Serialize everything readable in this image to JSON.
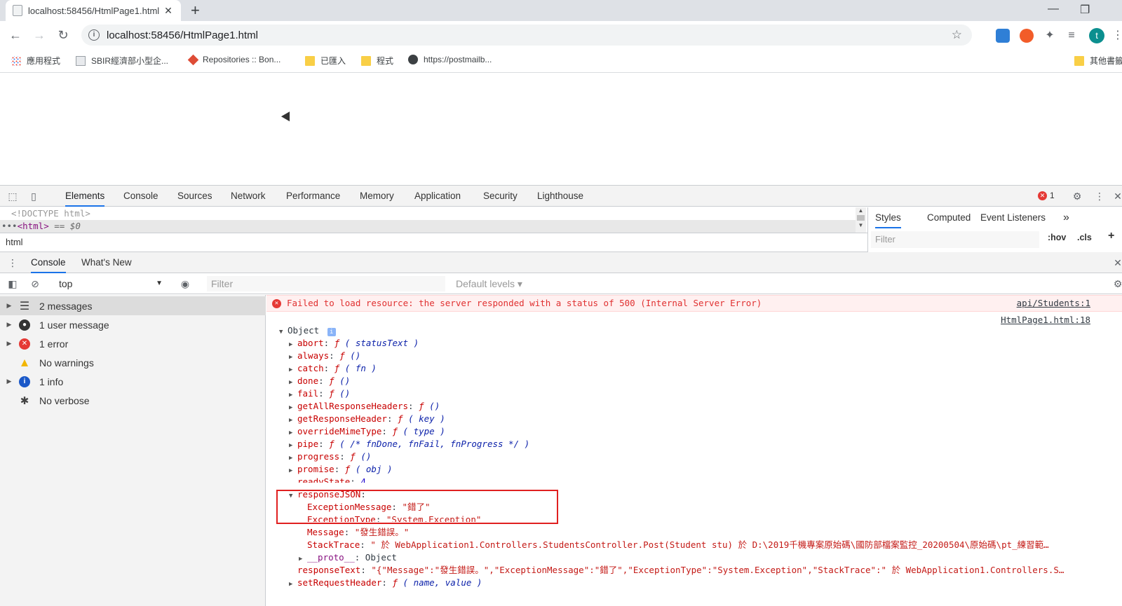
{
  "browser": {
    "tab_title": "localhost:58456/HtmlPage1.html",
    "new_tab_symbol": "+",
    "url": "localhost:58456/HtmlPage1.html",
    "profile_initial": "t"
  },
  "bookmarks": [
    {
      "label": "應用程式",
      "icon": "apps-grid-icon"
    },
    {
      "label": "SBIR經濟部小型企...",
      "icon": "page-icon"
    },
    {
      "label": "Repositories :: Bon...",
      "icon": "git-icon"
    },
    {
      "label": "已匯入",
      "icon": "folder-icon"
    },
    {
      "label": "程式",
      "icon": "folder-icon"
    },
    {
      "label": "https://postmailb...",
      "icon": "globe-icon"
    },
    {
      "label": "其他書籤",
      "icon": "folder-icon"
    }
  ],
  "devtools": {
    "tabs": [
      "Elements",
      "Console",
      "Sources",
      "Network",
      "Performance",
      "Memory",
      "Application",
      "Security",
      "Lighthouse"
    ],
    "active_tab": "Elements",
    "error_count": "1",
    "elements": {
      "line1": "<!DOCTYPE html>",
      "line2_prefix": "•••",
      "line2_tag": "<html>",
      "line2_suffix": " == $0",
      "breadcrumb": "html"
    },
    "styles": {
      "tabs": [
        "Styles",
        "Computed",
        "Event Listeners"
      ],
      "more": "»",
      "filter_placeholder": "Filter",
      "hov": ":hov",
      "cls": ".cls",
      "add": "+"
    },
    "drawer": {
      "tabs": [
        "Console",
        "What's New"
      ],
      "context": "top",
      "filter_placeholder": "Filter",
      "levels": "Default levels ▾"
    },
    "sidebar": [
      {
        "label": "2 messages",
        "icon": "list-icon",
        "expandable": true,
        "selected": true
      },
      {
        "label": "1 user message",
        "icon": "user-icon",
        "expandable": true
      },
      {
        "label": "1 error",
        "icon": "error-icon",
        "expandable": true
      },
      {
        "label": "No warnings",
        "icon": "warning-icon",
        "expandable": false
      },
      {
        "label": "1 info",
        "icon": "info-icon",
        "expandable": true
      },
      {
        "label": "No verbose",
        "icon": "bug-icon",
        "expandable": false
      }
    ],
    "console": {
      "error_text": "Failed to load resource: the server responded with a status of 500 (Internal Server Error)",
      "error_source": "api/Students:1",
      "log_source": "HtmlPage1.html:18",
      "object_label": "Object",
      "props": [
        {
          "key": "abort",
          "sig": "( statusText )"
        },
        {
          "key": "always",
          "sig": "()"
        },
        {
          "key": "catch",
          "sig": "( fn )"
        },
        {
          "key": "done",
          "sig": "()"
        },
        {
          "key": "fail",
          "sig": "()"
        },
        {
          "key": "getAllResponseHeaders",
          "sig": "()"
        },
        {
          "key": "getResponseHeader",
          "sig": "( key )"
        },
        {
          "key": "overrideMimeType",
          "sig": "( type )"
        },
        {
          "key": "pipe",
          "sig": "( /* fnDone, fnFail, fnProgress */ )"
        },
        {
          "key": "progress",
          "sig": "()"
        },
        {
          "key": "promise",
          "sig": "( obj )"
        }
      ],
      "ready_state_key": "readyState",
      "ready_state_val": "4",
      "response_json_key": "responseJSON",
      "exception_message_key": "ExceptionMessage",
      "exception_message_val": "\"錯了\"",
      "exception_type_key": "ExceptionType",
      "exception_type_val": "\"System.Exception\"",
      "message_key": "Message",
      "message_val": "\"發生錯誤。\"",
      "stacktrace_key": "StackTrace",
      "stacktrace_val": "\"   於 WebApplication1.Controllers.StudentsController.Post(Student stu) 於 D:\\2019千機專案原始碼\\國防部檔案監控_20200504\\原始碼\\pt_練習範…",
      "proto_key": "__proto__",
      "proto_val": "Object",
      "response_text_key": "responseText",
      "response_text_val": "\"{\"Message\":\"發生錯誤。\",\"ExceptionMessage\":\"錯了\",\"ExceptionType\":\"System.Exception\",\"StackTrace\":\"   於 WebApplication1.Controllers.S…",
      "set_request_header_key": "setRequestHeader",
      "set_request_header_sig": "( name, value )",
      "fn_symbol": "ƒ"
    }
  },
  "colors": {
    "accent": "#1a73e8",
    "error": "#e53935",
    "warning": "#f2b600",
    "info": "#1a58c8",
    "highlight_box": "#e02020"
  }
}
